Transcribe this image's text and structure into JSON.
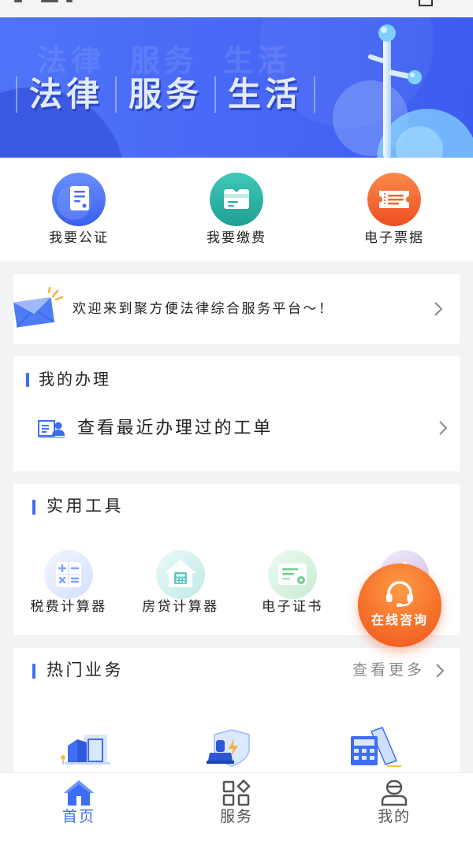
{
  "banner": {
    "words": [
      "法律",
      "服务",
      "生活"
    ],
    "background": "#4767f5",
    "art_icon": "scale-of-justice-icon"
  },
  "quick_actions": [
    {
      "label": "我要公证",
      "icon": "notary-document-icon",
      "color": "#4a6ef5"
    },
    {
      "label": "我要缴费",
      "icon": "payment-card-icon",
      "color": "#2ab3a5"
    },
    {
      "label": "电子票据",
      "icon": "ticket-icon",
      "color": "#f4622a"
    }
  ],
  "notice": {
    "icon": "envelope-icon",
    "text": "欢迎来到聚方便法律综合服务平台～！"
  },
  "my_affairs": {
    "title": "我的办理",
    "row_icon": "id-card-icon",
    "row_text": "查看最近办理过的工单"
  },
  "tools": {
    "title": "实用工具",
    "items": [
      {
        "label": "税费计算器",
        "icon": "calculator-icon",
        "color": "#e6eeff"
      },
      {
        "label": "房贷计算器",
        "icon": "house-calculator-icon",
        "color": "#d3f2f1"
      },
      {
        "label": "电子证书",
        "icon": "certificate-icon",
        "color": "#dcf3e3"
      },
      {
        "icon": "chart-icon",
        "color": "#e3d8f3"
      }
    ]
  },
  "floating_consult": {
    "label": "在线咨询",
    "icon": "headset-icon",
    "color": "#f7792f"
  },
  "hot_services": {
    "title": "热门业务",
    "more": "查看更多",
    "items": [
      {
        "icon": "building-icon"
      },
      {
        "icon": "shield-stamp-icon"
      },
      {
        "icon": "calculator-document-icon"
      }
    ]
  },
  "tab_bar": {
    "items": [
      {
        "label": "首页",
        "icon": "home-icon",
        "active": true
      },
      {
        "label": "服务",
        "icon": "grid-icon",
        "active": false
      },
      {
        "label": "我的",
        "icon": "user-icon",
        "active": false
      }
    ]
  },
  "colors": {
    "accent": "#3e6ef5",
    "background": "#f2f3f5",
    "text": "#222222",
    "muted": "#8a8a8a"
  }
}
